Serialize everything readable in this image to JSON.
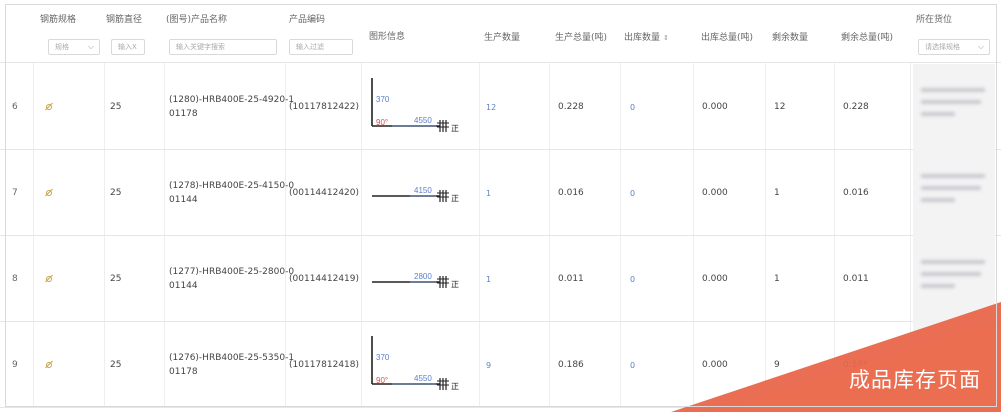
{
  "columns": {
    "spec": "钢筋规格",
    "diameter": "钢筋直径",
    "name": "(图号)产品名称",
    "code": "产品编码",
    "shape": "图形信息",
    "prod_qty": "生产数量",
    "prod_weight": "生产总量(吨)",
    "out_qty": "出库数量",
    "out_weight": "出库总量(吨)",
    "remain_qty": "剩余数量",
    "remain_weight": "剩余总量(吨)",
    "location": "所在货位"
  },
  "filters": {
    "spec_placeholder": "规格",
    "diameter_placeholder": "输入X",
    "name_placeholder": "输入关键字搜索",
    "code_placeholder": "输入过滤",
    "location_placeholder": "请选择规格"
  },
  "rows": [
    {
      "no": "6",
      "diameter": "25",
      "name": "(1280)-HRB400E-25-4920-101178",
      "name_l1": "(1280)-HRB400E-25-4920-1",
      "name_l2": "01178",
      "code": "(10117812422)",
      "shape_type": "L",
      "shape_v": "370",
      "shape_angle": "90°",
      "shape_h": "4550",
      "shape_mark": "正",
      "prod_qty": "12",
      "prod_weight": "0.228",
      "out_qty": "0",
      "out_weight": "0.000",
      "remain_qty": "12",
      "remain_weight": "0.228"
    },
    {
      "no": "7",
      "diameter": "25",
      "name": "(1278)-HRB400E-25-4150-001144",
      "name_l1": "(1278)-HRB400E-25-4150-0",
      "name_l2": "01144",
      "code": "(00114412420)",
      "shape_type": "straight",
      "shape_h": "4150",
      "shape_mark": "正",
      "prod_qty": "1",
      "prod_weight": "0.016",
      "out_qty": "0",
      "out_weight": "0.000",
      "remain_qty": "1",
      "remain_weight": "0.016"
    },
    {
      "no": "8",
      "diameter": "25",
      "name": "(1277)-HRB400E-25-2800-001144",
      "name_l1": "(1277)-HRB400E-25-2800-0",
      "name_l2": "01144",
      "code": "(00114412419)",
      "shape_type": "straight",
      "shape_h": "2800",
      "shape_mark": "正",
      "prod_qty": "1",
      "prod_weight": "0.011",
      "out_qty": "0",
      "out_weight": "0.000",
      "remain_qty": "1",
      "remain_weight": "0.011"
    },
    {
      "no": "9",
      "diameter": "25",
      "name": "(1276)-HRB400E-25-5350-101178",
      "name_l1": "(1276)-HRB400E-25-5350-1",
      "name_l2": "01178",
      "code": "(10117812418)",
      "shape_type": "L",
      "shape_v": "370",
      "shape_angle": "90°",
      "shape_h": "4550",
      "shape_mark": "正",
      "prod_qty": "9",
      "prod_weight": "0.186",
      "out_qty": "0",
      "out_weight": "0.000",
      "remain_qty": "9",
      "remain_weight": "0.186"
    }
  ],
  "ribbon_label": "成品库存页面",
  "colors": {
    "accent_blue": "#5b7fc7",
    "angle_red": "#d9534f",
    "ribbon": "#e8664a",
    "border": "#e6e6e6"
  }
}
